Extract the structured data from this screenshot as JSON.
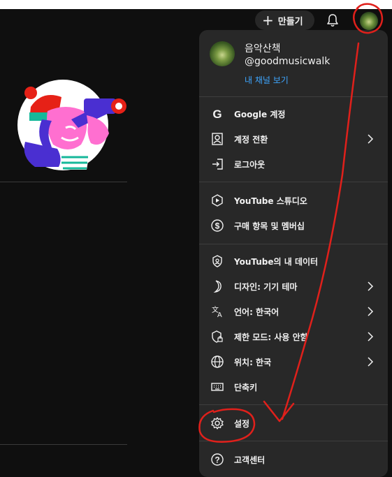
{
  "header": {
    "create_label": "만들기",
    "create_icon": "plus-icon",
    "bell_icon": "bell-icon"
  },
  "menu": {
    "profile": {
      "name": "음악산책",
      "handle": "@goodmusicwalk",
      "channel_link": "내 채널 보기"
    },
    "sections": [
      [
        {
          "label": "Google 계정",
          "icon": "google-icon"
        },
        {
          "label": "계정 전환",
          "icon": "switch-account-icon"
        },
        {
          "label": "로그아웃",
          "icon": "sign-out-icon"
        }
      ],
      [
        {
          "label": "YouTube 스튜디오",
          "icon": "studio-icon"
        },
        {
          "label": "구매 항목 및 멤버십",
          "icon": "dollar-icon"
        }
      ],
      [
        {
          "label": "YouTube의 내 데이터",
          "icon": "shield-person-icon"
        },
        {
          "label": "디자인: 기기 테마",
          "icon": "moon-icon"
        },
        {
          "label": "언어: 한국어",
          "icon": "translate-icon"
        },
        {
          "label": "제한 모드: 사용 안함",
          "icon": "restricted-mode-icon"
        },
        {
          "label": "위치: 한국",
          "icon": "globe-icon"
        },
        {
          "label": "단축키",
          "icon": "keyboard-icon"
        }
      ],
      [
        {
          "label": "설정",
          "icon": "gear-icon"
        }
      ],
      [
        {
          "label": "고객센터",
          "icon": "help-icon"
        }
      ]
    ]
  },
  "colors": {
    "background": "#0f0f0f",
    "menu_background": "#282828",
    "link": "#3ea6ff",
    "annotation": "#e0201b"
  }
}
